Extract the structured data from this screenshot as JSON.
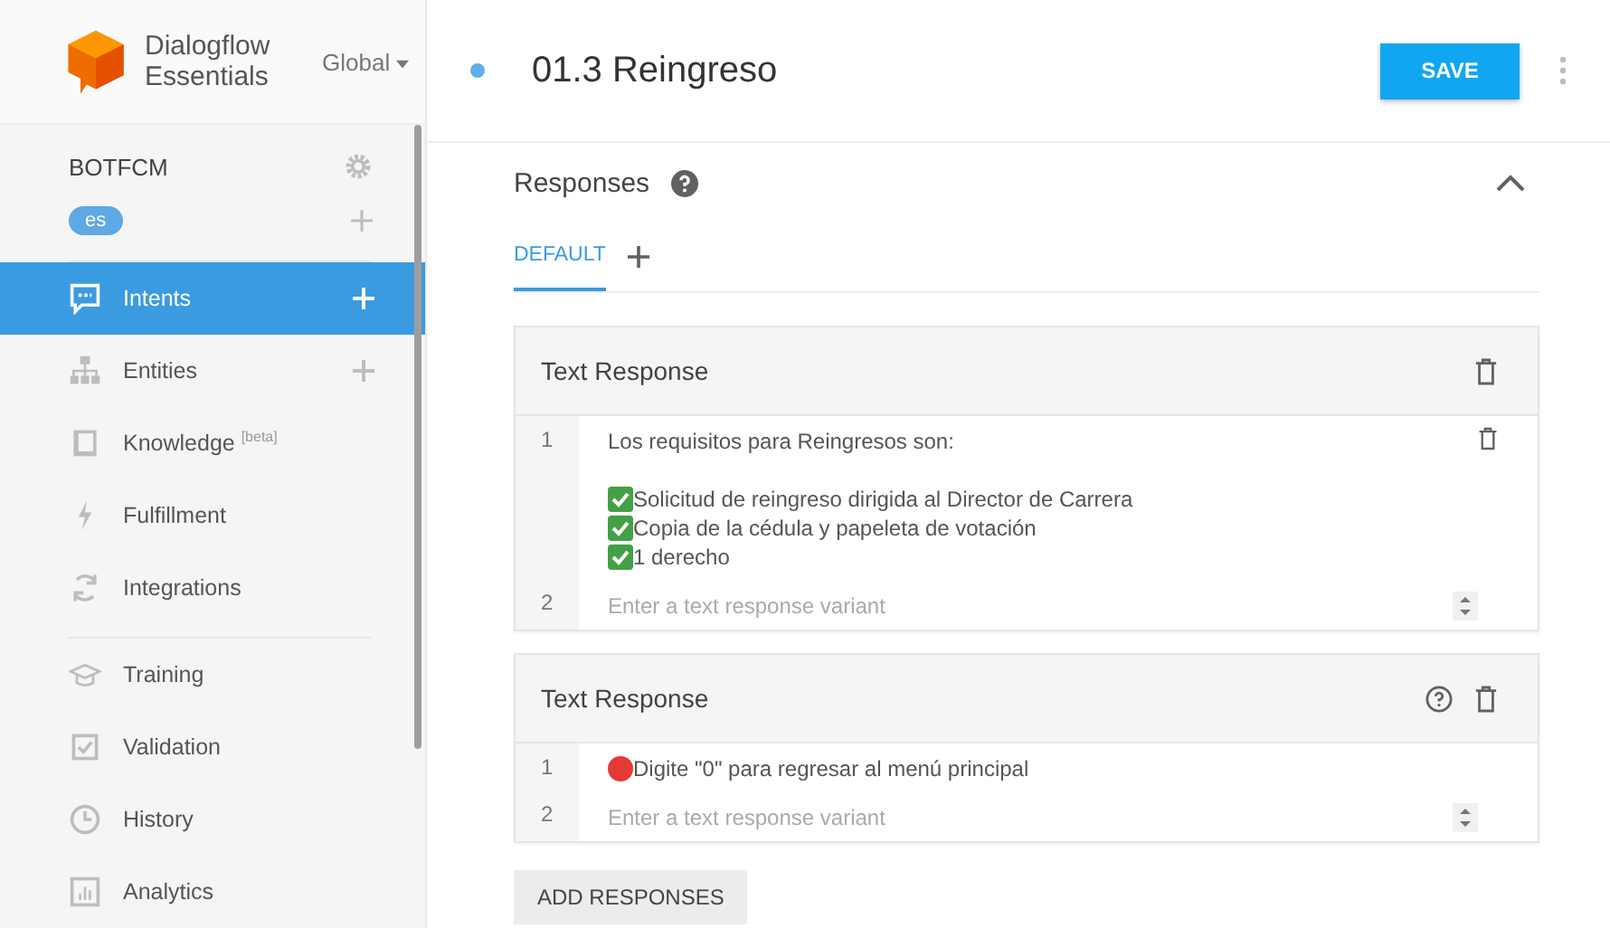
{
  "sidebar": {
    "brand": "Dialogflow Essentials",
    "region": "Global",
    "agent": "BOTFCM",
    "language": "es",
    "nav_groups": [
      [
        {
          "label": "Intents",
          "selected": true,
          "add": true
        },
        {
          "label": "Entities",
          "selected": false,
          "add": true
        },
        {
          "label": "Knowledge $^{[beta]}$",
          "selected": false,
          "add": false
        },
        {
          "label": "Fulfillment",
          "selected": false,
          "add": false
        },
        {
          "label": "Integrations",
          "selected": false,
          "add": false
        }
      ],
      [
        {
          "label": "Training",
          "selected": false,
          "add": false
        },
        {
          "label": "Validation",
          "selected": false,
          "add": false
        },
        {
          "label": "History",
          "selected": false,
          "add": false
        },
        {
          "label": "Analytics",
          "selected": false,
          "add": false
        }
      ]
    ]
  },
  "header": {
    "title": "01.3 Reingreso",
    "save": "SAVE"
  },
  "responses": {
    "title": "Responses",
    "tabs": [
      {
        "label": "DEFAULT",
        "selected": true
      }
    ],
    "cards": [
      {
        "title": "Text Response",
        "help": false,
        "rows": [
          {
            "number": "1",
            "delete": true,
            "lines": [
              {
                "kind": "plain",
                "text": "Los requisitos para Reingresos son:"
              },
              {
                "kind": "check",
                "text": "Solicitud de reingreso dirigida al Director de Carrera"
              },
              {
                "kind": "check",
                "text": "Copia de la cédula y papeleta de votación"
              },
              {
                "kind": "check",
                "text": "1 derecho"
              }
            ]
          }
        ],
        "variant": {
          "number": "2",
          "placeholder": "Enter a text response variant"
        }
      },
      {
        "title": "Text Response",
        "help": true,
        "rows": [
          {
            "number": "1",
            "delete": false,
            "lines": [
              {
                "kind": "red-dot",
                "text": "Digite \"0\" para regresar al menú principal"
              }
            ]
          }
        ],
        "variant": {
          "number": "2",
          "placeholder": "Enter a text response variant"
        }
      }
    ],
    "add_button": "ADD RESPONSES"
  }
}
